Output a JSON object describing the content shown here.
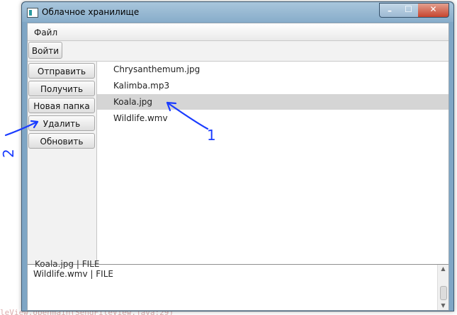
{
  "background_code": "leView.openmain(SendFileView.java:29)",
  "window": {
    "title": "Облачное хранилище",
    "controls": {
      "minimize": "–",
      "maximize": "☐",
      "close": "✕"
    }
  },
  "menu": {
    "file_label": "Файл"
  },
  "toolbar": {
    "login_label": "Войти"
  },
  "sidebar": {
    "buttons": [
      {
        "label": "Отправить"
      },
      {
        "label": "Получить"
      },
      {
        "label": "Новая папка"
      },
      {
        "label": "Удалить"
      },
      {
        "label": "Обновить"
      }
    ]
  },
  "files": [
    {
      "name": "Chrysanthemum.jpg",
      "selected": false
    },
    {
      "name": "Kalimba.mp3",
      "selected": false
    },
    {
      "name": "Koala.jpg",
      "selected": true
    },
    {
      "name": "Wildlife.wmv",
      "selected": false
    }
  ],
  "log": {
    "previous_partial": "Koala.jpg | FILE",
    "last_line": "Wildlife.wmv | FILE"
  },
  "annotations": {
    "arrow_1_label": "1",
    "arrow_2_label": "2",
    "color": "#1a3cff"
  }
}
